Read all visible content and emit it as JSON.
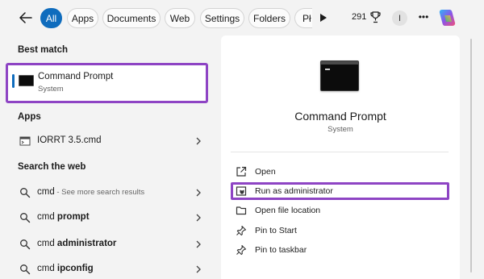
{
  "filters": {
    "tabs": [
      "All",
      "Apps",
      "Documents",
      "Web",
      "Settings",
      "Folders",
      "Pł"
    ],
    "active": "All"
  },
  "header": {
    "points": "291",
    "avatar_initial": "I",
    "more_label": "•••"
  },
  "best_match": {
    "heading": "Best match",
    "title": "Command Prompt",
    "subtitle": "System"
  },
  "apps": {
    "heading": "Apps",
    "items": [
      {
        "label": "IORRT 3.5.cmd"
      }
    ]
  },
  "web": {
    "heading": "Search the web",
    "items": [
      {
        "prefix": "cmd",
        "bold": "",
        "muted": " - See more search results"
      },
      {
        "prefix": "cmd ",
        "bold": "prompt",
        "muted": ""
      },
      {
        "prefix": "cmd ",
        "bold": "administrator",
        "muted": ""
      },
      {
        "prefix": "cmd ",
        "bold": "ipconfig",
        "muted": ""
      }
    ]
  },
  "preview": {
    "title": "Command Prompt",
    "subtitle": "System",
    "actions": [
      {
        "label": "Open",
        "icon": "open-external-icon"
      },
      {
        "label": "Run as administrator",
        "icon": "shield-icon"
      },
      {
        "label": "Open file location",
        "icon": "folder-icon"
      },
      {
        "label": "Pin to Start",
        "icon": "pin-icon"
      },
      {
        "label": "Pin to taskbar",
        "icon": "pin-icon"
      }
    ]
  },
  "colors": {
    "accent": "#0f6cbd",
    "highlight": "#8e44c4"
  }
}
